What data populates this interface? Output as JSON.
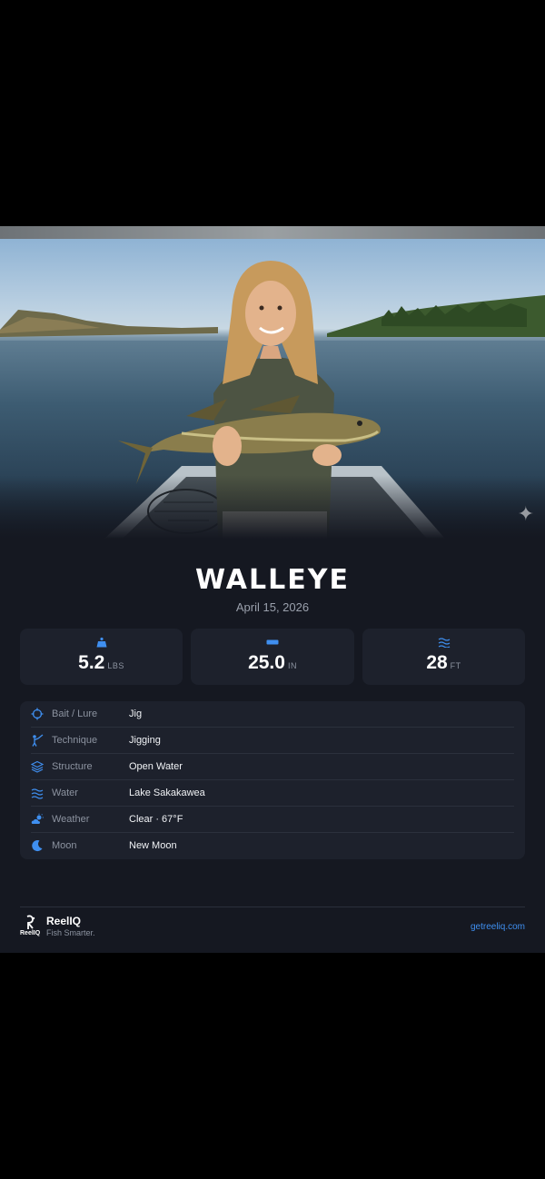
{
  "catch": {
    "species": "WALLEYE",
    "date": "April 15, 2026"
  },
  "stats": [
    {
      "icon": "weight-icon",
      "value": "5.2",
      "unit": "LBS"
    },
    {
      "icon": "ruler-icon",
      "value": "25.0",
      "unit": "IN"
    },
    {
      "icon": "depth-waves-icon",
      "value": "28",
      "unit": "FT"
    }
  ],
  "details": [
    {
      "icon": "crosshair-icon",
      "label": "Bait / Lure",
      "value": "Jig"
    },
    {
      "icon": "angler-icon",
      "label": "Technique",
      "value": "Jigging"
    },
    {
      "icon": "layers-icon",
      "label": "Structure",
      "value": "Open Water"
    },
    {
      "icon": "water-waves-icon",
      "label": "Water",
      "value": "Lake Sakakawea"
    },
    {
      "icon": "partly-cloudy-icon",
      "label": "Weather",
      "value": "Clear · 67°F"
    },
    {
      "icon": "moon-icon",
      "label": "Moon",
      "value": "New Moon"
    }
  ],
  "footer": {
    "logo_text": "ReelIQ",
    "brand": "ReelIQ",
    "tagline": "Fish Smarter.",
    "site": "getreeliq.com"
  },
  "colors": {
    "accent": "#3f8ff0",
    "card_bg": "#151821",
    "panel_bg": "#1d212c"
  }
}
